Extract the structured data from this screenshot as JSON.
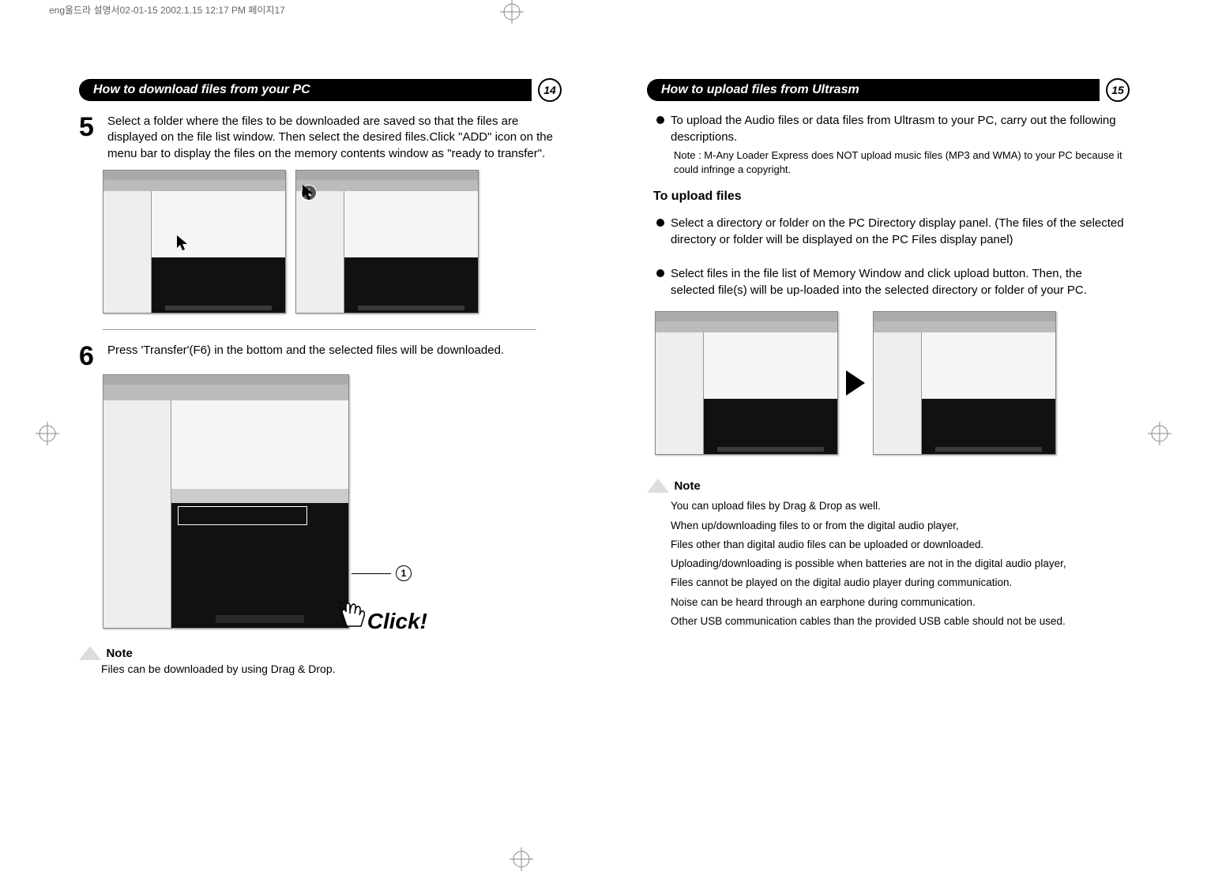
{
  "header_crop_text": "eng울드라 설명서02-01-15  2002.1.15 12:17 PM  페이지17",
  "left_page": {
    "section_title": "How to download files from your PC",
    "page_number": "14",
    "step5_num": "5",
    "step5_text": "Select a folder where the files to be downloaded are saved so that the files are displayed on the file list window. Then select the desired files.Click \"ADD\" icon on the menu bar to display the files on the memory contents window as \"ready to transfer\".",
    "step6_num": "6",
    "step6_text": "Press 'Transfer'(F6) in the bottom and the selected files will be downloaded.",
    "click_label": "Click!",
    "callout_1": "1",
    "callout_right": "1",
    "note_label": "Note",
    "note_body": "Files can be downloaded by using Drag & Drop."
  },
  "right_page": {
    "section_title": "How to upload files from Ultrasm",
    "page_number": "15",
    "intro": "To upload the Audio files or data files from Ultrasm to your PC, carry out the following descriptions.",
    "intro_note": "Note : M-Any Loader Express does NOT upload music files (MP3 and WMA) to your PC because it could infringe a copyright.",
    "subhead": "To upload files",
    "bullet1": "Select a directory or folder on the PC Directory   display panel. (The files of the selected directory or folder will be displayed on the PC Files display panel)",
    "bullet2": "Select files in the file list of Memory Window and click upload button. Then, the selected file(s) will be up-loaded into the selected directory or folder of your PC.",
    "note_label": "Note",
    "notes": [
      "You can upload files by Drag & Drop as well.",
      "When up/downloading files to or from the digital audio player,",
      "Files other than digital audio files can be uploaded or downloaded.",
      "Uploading/downloading is possible when batteries are not in the digital audio player,",
      "Files cannot be played on the digital audio player during communication.",
      "Noise can be heard through an earphone during communication.",
      "Other USB communication cables than the provided USB cable should not be used."
    ]
  }
}
